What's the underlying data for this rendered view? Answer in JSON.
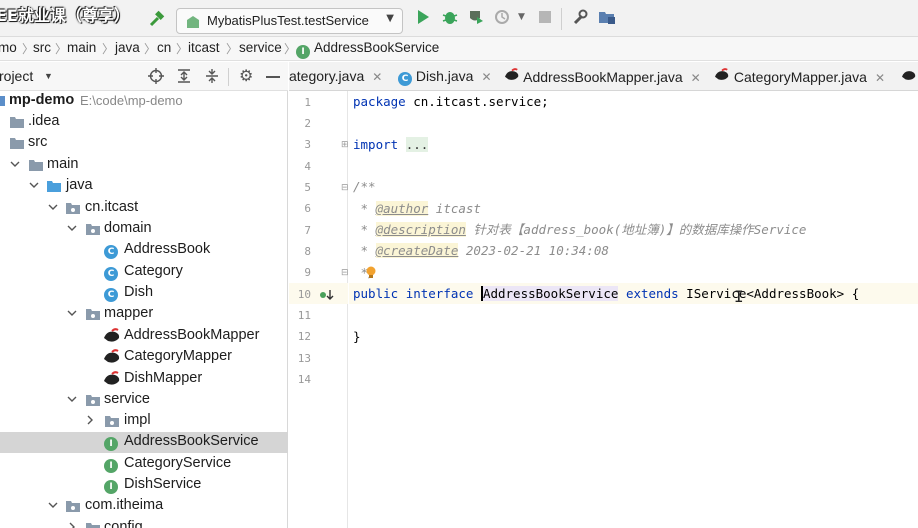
{
  "toolbar": {
    "watermark": "EE就业课（尊享）",
    "run_config": "MybatisPlusTest.testService"
  },
  "breadcrumb": [
    "mo",
    "src",
    "main",
    "java",
    "cn",
    "itcast",
    "service",
    "AddressBookService"
  ],
  "project_panel": {
    "title": "roject",
    "tree": [
      {
        "label": "mp-demo",
        "path": "E:\\code\\mp-demo",
        "icon": "module-folder-icon",
        "bold": true
      },
      {
        "label": ".idea",
        "icon": "folder-icon"
      },
      {
        "label": "src",
        "icon": "folder-icon"
      },
      {
        "label": "main",
        "icon": "folder-icon"
      },
      {
        "label": "java",
        "icon": "source-folder-icon"
      },
      {
        "label": "cn.itcast",
        "icon": "package-icon"
      },
      {
        "label": "domain",
        "icon": "package-icon"
      },
      {
        "label": "AddressBook",
        "icon": "class-icon"
      },
      {
        "label": "Category",
        "icon": "class-icon"
      },
      {
        "label": "Dish",
        "icon": "class-icon"
      },
      {
        "label": "mapper",
        "icon": "package-icon"
      },
      {
        "label": "AddressBookMapper",
        "icon": "mybatis-mapper-icon"
      },
      {
        "label": "CategoryMapper",
        "icon": "mybatis-mapper-icon"
      },
      {
        "label": "DishMapper",
        "icon": "mybatis-mapper-icon"
      },
      {
        "label": "service",
        "icon": "package-icon"
      },
      {
        "label": "impl",
        "icon": "package-icon"
      },
      {
        "label": "AddressBookService",
        "icon": "interface-icon",
        "selected": true
      },
      {
        "label": "CategoryService",
        "icon": "interface-icon"
      },
      {
        "label": "DishService",
        "icon": "interface-icon"
      },
      {
        "label": "com.itheima",
        "icon": "package-icon"
      },
      {
        "label": "config",
        "icon": "package-icon"
      }
    ]
  },
  "tabs": [
    {
      "label": "ategory.java",
      "icon": "java-file-icon"
    },
    {
      "label": "Dish.java",
      "icon": "class-icon"
    },
    {
      "label": "AddressBookMapper.java",
      "icon": "mybatis-mapper-icon"
    },
    {
      "label": "CategoryMapper.java",
      "icon": "mybatis-mapper-icon"
    }
  ],
  "editor": {
    "line_numbers": [
      "1",
      "2",
      "3",
      "4",
      "5",
      "6",
      "7",
      "8",
      "9",
      "10",
      "11",
      "12",
      "13",
      "14"
    ],
    "code": {
      "l1_kw": "package",
      "l1_rest": " cn.itcast.service;",
      "l3_kw": "import",
      "l3_fold": "...",
      "l6": "/**",
      "l7_star": " * ",
      "l7_tag": "@author",
      "l7_val": " itcast",
      "l8_star": " * ",
      "l8_tag": "@description",
      "l8_val": " 针对表【address_book(地址簿)】的数据库操作Service",
      "l9_star": " * ",
      "l9_tag": "@createDate",
      "l9_val": " 2023-02-21 10:34:08",
      "l10": " */",
      "l11_kw1": "public",
      "l11_kw2": "interface",
      "l11_name": "AddressBookService",
      "l11_kw3": "extends",
      "l11_rest": " IService<AddressBook> {",
      "l13": "}"
    }
  }
}
